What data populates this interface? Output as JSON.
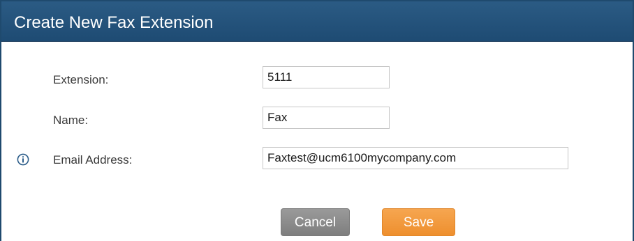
{
  "dialog": {
    "title": "Create New Fax Extension"
  },
  "form": {
    "extension": {
      "label": "Extension:",
      "value": "5111"
    },
    "name": {
      "label": "Name:",
      "value": "Fax"
    },
    "email": {
      "label": "Email Address:",
      "value": "Faxtest@ucm6100mycompany.com"
    }
  },
  "buttons": {
    "cancel": "Cancel",
    "save": "Save"
  },
  "icons": {
    "info": "info-icon"
  },
  "colors": {
    "title_bar": "#1e4b73",
    "save_button": "#f0922f",
    "cancel_button": "#8a8a8a"
  }
}
